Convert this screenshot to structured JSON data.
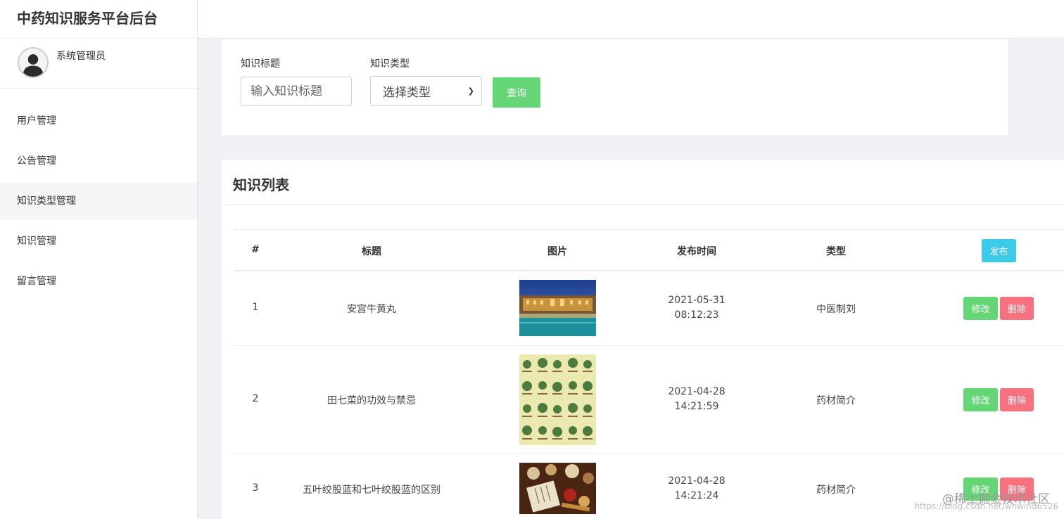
{
  "app": {
    "title": "中药知识服务平台后台"
  },
  "user": {
    "name": "系统管理员"
  },
  "nav": {
    "items": [
      {
        "label": "用户管理"
      },
      {
        "label": "公告管理"
      },
      {
        "label": "知识类型管理"
      },
      {
        "label": "知识管理"
      },
      {
        "label": "留言管理"
      }
    ]
  },
  "filter": {
    "title_label": "知识标题",
    "title_placeholder": "输入知识标题",
    "type_label": "知识类型",
    "type_selected": "选择类型",
    "query_label": "查询"
  },
  "list": {
    "title": "知识列表",
    "headers": {
      "index": "#",
      "title": "标题",
      "image": "图片",
      "time": "发布时间",
      "type": "类型"
    },
    "publish_label": "发布",
    "edit_label": "修改",
    "delete_label": "删除",
    "rows": [
      {
        "index": "1",
        "title": "安宫牛黄丸",
        "date": "2021-05-31",
        "time": "08:12:23",
        "type": "中医制刘",
        "image": "palace-night-photo"
      },
      {
        "index": "2",
        "title": "田七菜的功效与禁忌",
        "date": "2021-04-28",
        "time": "14:21:59",
        "type": "药材简介",
        "image": "herb-chart-photo"
      },
      {
        "index": "3",
        "title": "五叶绞股蓝和七叶绞股蓝的区别",
        "date": "2021-04-28",
        "time": "14:21:24",
        "type": "药材简介",
        "image": "herbal-medicine-photo"
      }
    ]
  },
  "watermark": {
    "text": "@稀土掘金技术社区",
    "url_text": "https://blog.csdn.net/whwind6526"
  },
  "colors": {
    "query": "#64d676",
    "publish": "#3bcbe8",
    "edit": "#64d676",
    "delete": "#f7717f"
  }
}
